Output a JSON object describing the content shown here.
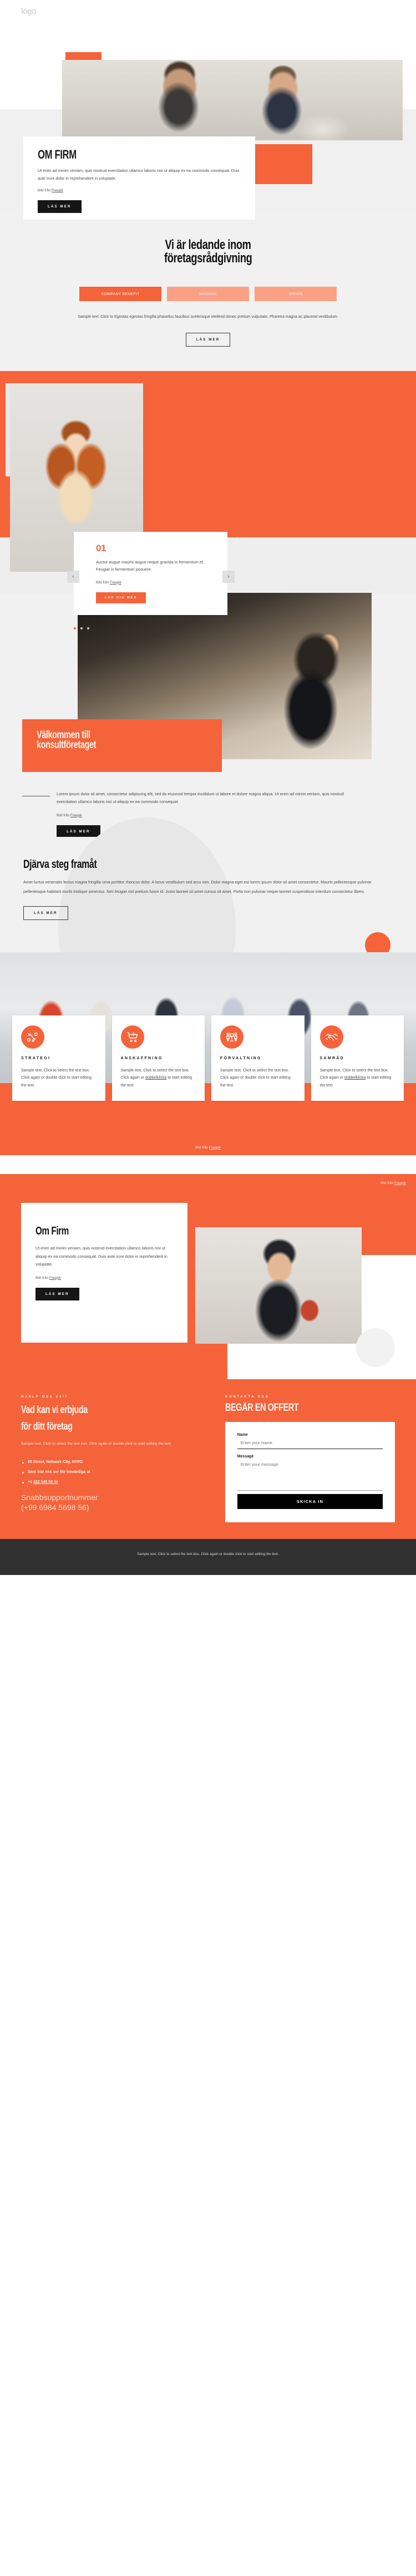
{
  "brand": {
    "accent": "#f4633a",
    "accent_light": "#faa085",
    "dark": "#161616",
    "logo": "logo"
  },
  "hero": {
    "about": {
      "title": "OM FIRM",
      "body": "Ut enim ad minim veniam, quis nostrud exercitation ullamco laboris nisi ut aliquip ex ea commodo consequat. Duis aute irure dolor in reprehenderit in voluptate.",
      "credit_prefix": "Bild från ",
      "credit_link": "Freepik",
      "button": "LÄS MER"
    }
  },
  "leading": {
    "title_line1": "Vi är ledande inom",
    "title_line2": "företagsrådgivning",
    "tabs": [
      {
        "label": "COMPANY BENEFIT",
        "active": true
      },
      {
        "label": "MISSION",
        "active": false
      },
      {
        "label": "VISION",
        "active": false
      }
    ],
    "sample": "Sample text. Click to Egestas egestas fringilla phasellus faucibus scelerisque eleifend donec pretium vulputate. Pharetra magna ac placerat vestibulum.",
    "button": "LÄS MER"
  },
  "slider": {
    "number": "01",
    "body": "Auctor augue mauris augue neque gravida in fermentum et. Feugiat in fermentum posuere.",
    "credit_prefix": "Bild från ",
    "credit_link": "Freepik",
    "button": "LÄR DIG MER",
    "prev_icon": "chevron-left-icon",
    "next_icon": "chevron-right-icon",
    "dots": 3,
    "active_dot": 0
  },
  "welcome": {
    "title_line1": "Välkommen till",
    "title_line2": "konsultföretaget",
    "body": "Lorem ipsum dolor sit amet, consectetur adipiscing elit, sed do eiusmod tempor incididunt ut labore et dolore magna aliqua. Ut enim ad minim veniam, quis nostrud exercitation ullamco laboris nisi ut aliquip ex ea commodo consequat.",
    "credit_prefix": "Bild från ",
    "credit_link": "Freepik",
    "button": "LÄS MER"
  },
  "bold": {
    "title": "Djärva steg framåt",
    "body": "Amet luctus venenatis lectus magna fringilla urna porttitor rhoncus dolor. A lacus vestibulum sed arcu non. Dolor magna eget est lorem ipsum dolor sit amet consectetur. Mauris pellentesque pulvinar pellentesque habitant morbi tristique senectus. Nec feugiat nisl pretium fusce id. Justo laoreet sit amet cursus sit amet. Porta non pulvinar neque laoreet suspendisse interdum consectetur libero.",
    "button": "LÄS MER"
  },
  "services": {
    "cards": [
      {
        "icon": "strategy-icon",
        "title": "STRATEGI",
        "body_before": "Sample text. Click to select the text box. Click again or double click to start editing the text.",
        "body_link": "",
        "body_after": ""
      },
      {
        "icon": "shopping-cart-icon",
        "title": "ANSKAFFNING",
        "body_before": "Sample text. Click to select the text box. Click again or ",
        "body_link": "dubbelklicka",
        "body_after": " to start editing the text."
      },
      {
        "icon": "consulting-people-icon",
        "title": "FÖRVALTNING",
        "body_before": "Sample text. Click to select the text box. Click again or double click to start editing the text.",
        "body_link": "",
        "body_after": ""
      },
      {
        "icon": "handshake-icon",
        "title": "SAMRÅD",
        "body_before": "Sample text. Click to select the text box. Click again or ",
        "body_link": "dubbelklicka",
        "body_after": " to start editing the text."
      }
    ],
    "credit_prefix": "Bild från ",
    "credit_link": "Freepik"
  },
  "omfirm": {
    "credit_top_prefix": "Bild från ",
    "credit_top_link": "Freepik",
    "title": "Om Firm",
    "body": "Ut enim ad minim veniam, quis nostrud exercitation ullamco laboris nisi ut aliquip ex ea commodo consequat. Duis aute irure dolor in reprehenderit in voluptate.",
    "credit_prefix": "Bild från ",
    "credit_link": "Freepik",
    "button": "LÄS MER"
  },
  "contact": {
    "eyebrow": "HJÄLP OSS 24/7",
    "title_line1": "Vad kan vi erbjuda",
    "title_line2": "för ditt företag",
    "sample": "Sample text. Click to select the text box. Click again or double click to start editing the text.",
    "list": [
      {
        "text": "65 Street, Network City, NYPD",
        "underline": ""
      },
      {
        "text": "Som inte ens ser lite trovärdiga ut",
        "underline": ""
      },
      {
        "text_before": "+1 ",
        "underline": "222 545 55 44",
        "text_after": ""
      }
    ],
    "support_line1": "Snabbsupportnummer",
    "support_line2": "(+99 6984 5698 56)",
    "form": {
      "eyebrow": "KONTAKTA OSS",
      "title": "BEGÄR EN OFFERT",
      "name_label": "Name",
      "name_placeholder": "Enter your Name",
      "name_value": "",
      "message_label": "Message",
      "message_placeholder": "Enter your message",
      "message_value": "",
      "submit": "SKICKA IN"
    }
  },
  "footer": {
    "text": "Sample text. Click to select the text box. Click again or double click to start editing the text."
  }
}
